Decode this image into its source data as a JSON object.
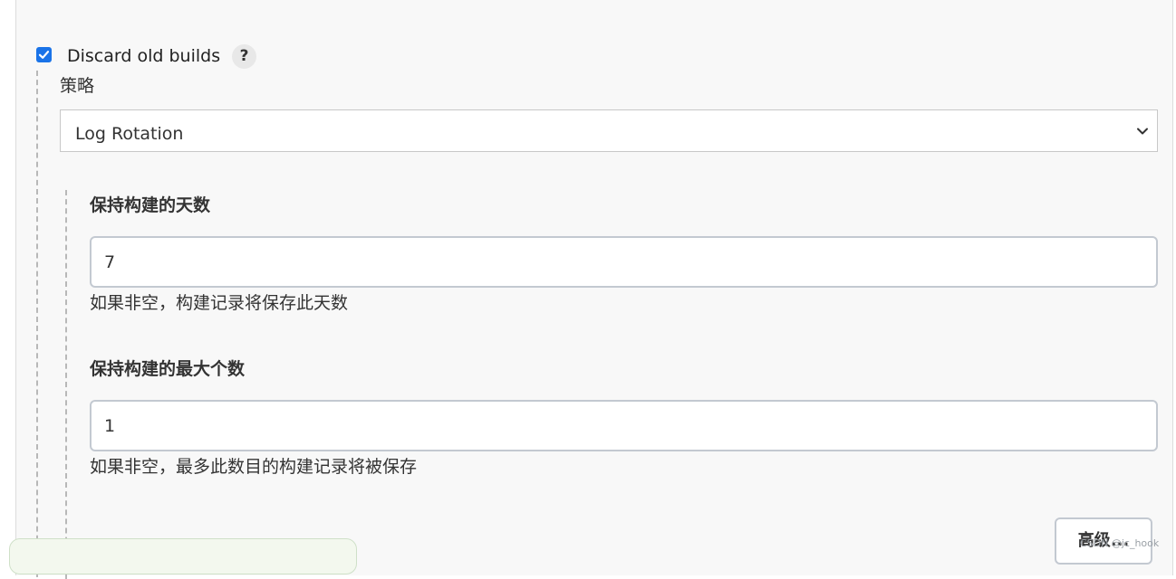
{
  "discard": {
    "checked": true,
    "label": "Discard old builds",
    "help": "?"
  },
  "strategy": {
    "label": "策略",
    "selected": "Log Rotation"
  },
  "days": {
    "label": "保持构建的天数",
    "value": "7",
    "help": "如果非空，构建记录将保存此天数"
  },
  "max_builds": {
    "label": "保持构建的最大个数",
    "value": "1",
    "help": "如果非空，最多此数目的构建记录将被保存"
  },
  "advanced_button": "高级...",
  "watermark": "CSDN @jc_hook",
  "colors": {
    "checkbox": "#1a73e8",
    "panel_bg": "#f8f8f8",
    "input_border": "#c3c9d1"
  }
}
